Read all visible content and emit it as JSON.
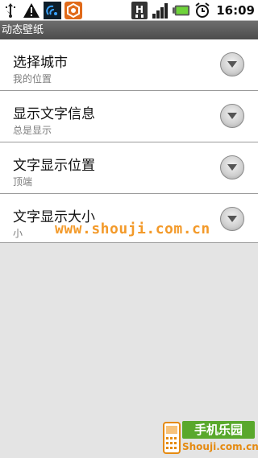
{
  "status_bar": {
    "left_icons": [
      "usb-icon",
      "warning-icon",
      "sync-icon",
      "app-icon"
    ],
    "right_icons": [
      "network-h-icon",
      "signal-icon",
      "battery-icon",
      "alarm-icon"
    ],
    "time": "16:09"
  },
  "title_bar": {
    "title": "动态壁纸"
  },
  "settings": [
    {
      "title": "选择城市",
      "summary": "我的位置"
    },
    {
      "title": "显示文字信息",
      "summary": "总是显示"
    },
    {
      "title": "文字显示位置",
      "summary": "顶端"
    },
    {
      "title": "文字显示大小",
      "summary": "小"
    }
  ],
  "watermark": "www.shouji.com.cn",
  "logo": {
    "top_text": "手机乐园",
    "bottom_text": "Shouji.com.cn"
  },
  "colors": {
    "watermark": "#f39a2a",
    "logo_green": "#59a82c",
    "logo_orange": "#e58a10"
  }
}
